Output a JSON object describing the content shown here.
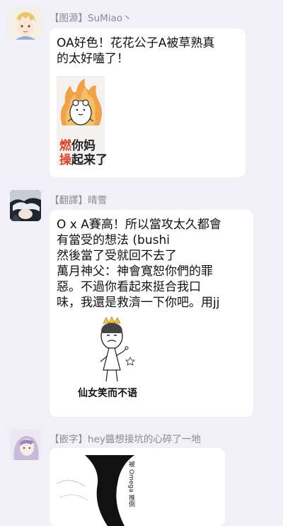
{
  "messages": [
    {
      "sender": "【图源】SuMiao丶",
      "text": "OA好色！花花公子A被草熟真\n的太好嗑了！",
      "sticker": {
        "line1_a": "燃",
        "line1_b": "你妈",
        "line2_a": "操",
        "line2_b": "起来了"
      }
    },
    {
      "sender": "【翻譯】晴雪",
      "text": "O x A賽高！所以當攻太久都會\n有當受的想法 (bushi\n然後當了受就回不去了\n萬月神父：神會寬恕你們的罪\n惡。不過你看起來挺合我口\n味，我還是救濟一下你吧。用jj",
      "sticker": {
        "caption": "仙女笑而不语"
      }
    },
    {
      "sender": "【嵌字】hey醬想接坑的心碎了一地",
      "image": {
        "vertical_text": "被 Omega 推倒"
      }
    }
  ],
  "colors": {
    "background": "#f1f0f6",
    "bubble": "#ffffff",
    "sender_text": "#8a8a8f",
    "sticker_red": "#d4452b"
  }
}
